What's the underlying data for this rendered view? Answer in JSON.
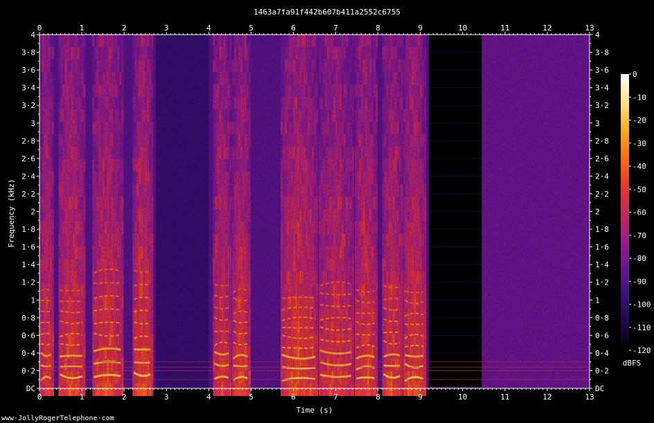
{
  "chart_data": {
    "type": "heatmap",
    "title": "1463a7fa91f442b607b411a2552c6755",
    "xlabel": "Time (s)",
    "ylabel": "Frequency (kHz)",
    "xlim": [
      0,
      13
    ],
    "ylim": [
      0,
      4
    ],
    "x_ticks": [
      "0",
      "1",
      "2",
      "3",
      "4",
      "5",
      "6",
      "7",
      "8",
      "9",
      "10",
      "11",
      "12",
      "13"
    ],
    "y_ticks": [
      {
        "value": 0,
        "label": "DC"
      },
      {
        "value": 0.2,
        "label": "0·2"
      },
      {
        "value": 0.4,
        "label": "0·4"
      },
      {
        "value": 0.6,
        "label": "0·6"
      },
      {
        "value": 0.8,
        "label": "0·8"
      },
      {
        "value": 1.0,
        "label": "1"
      },
      {
        "value": 1.2,
        "label": "1·2"
      },
      {
        "value": 1.4,
        "label": "1·4"
      },
      {
        "value": 1.6,
        "label": "1·6"
      },
      {
        "value": 1.8,
        "label": "1·8"
      },
      {
        "value": 2.0,
        "label": "2"
      },
      {
        "value": 2.2,
        "label": "2·2"
      },
      {
        "value": 2.4,
        "label": "2·4"
      },
      {
        "value": 2.6,
        "label": "2·6"
      },
      {
        "value": 2.8,
        "label": "2·8"
      },
      {
        "value": 3.0,
        "label": "3"
      },
      {
        "value": 3.2,
        "label": "3·2"
      },
      {
        "value": 3.4,
        "label": "3·4"
      },
      {
        "value": 3.6,
        "label": "3·6"
      },
      {
        "value": 3.8,
        "label": "3·8"
      },
      {
        "value": 4.0,
        "label": "4"
      }
    ],
    "colorbar": {
      "label": "dBFS",
      "range": [
        -120,
        0
      ],
      "ticks": [
        "0",
        "-10",
        "-20",
        "-30",
        "-40",
        "-50",
        "-60",
        "-70",
        "-80",
        "-90",
        "-100",
        "-110",
        "-120"
      ]
    },
    "colormap": [
      "#000000",
      "#1a0a4a",
      "#3d0f7a",
      "#6a1590",
      "#9a1e86",
      "#c8275e",
      "#ea3a2b",
      "#fb6e12",
      "#fcae1e",
      "#fde68a",
      "#ffffff"
    ],
    "speech_segments": [
      {
        "start": 0.0,
        "end": 0.3,
        "intensity": 0.75
      },
      {
        "start": 0.45,
        "end": 1.05,
        "intensity": 0.8
      },
      {
        "start": 1.25,
        "end": 1.95,
        "intensity": 0.8
      },
      {
        "start": 2.2,
        "end": 2.65,
        "intensity": 0.85
      },
      {
        "start": 4.1,
        "end": 4.5,
        "intensity": 0.75
      },
      {
        "start": 4.55,
        "end": 4.95,
        "intensity": 0.8
      },
      {
        "start": 5.7,
        "end": 6.55,
        "intensity": 0.85
      },
      {
        "start": 6.6,
        "end": 7.4,
        "intensity": 0.75
      },
      {
        "start": 7.45,
        "end": 7.95,
        "intensity": 0.8
      },
      {
        "start": 8.1,
        "end": 8.55,
        "intensity": 0.8
      },
      {
        "start": 8.6,
        "end": 9.1,
        "intensity": 0.85
      }
    ],
    "silence_segment": {
      "start": 9.2,
      "end": 10.45
    },
    "hum_tones_khz": [
      0.1,
      0.2,
      0.24,
      0.3
    ],
    "low_level_regions": [
      {
        "start": 2.75,
        "end": 4.0,
        "level": 0.18
      },
      {
        "start": 10.45,
        "end": 13.0,
        "level": 0.3
      }
    ],
    "watermark": "www·JollyRogerTelephone·com"
  }
}
